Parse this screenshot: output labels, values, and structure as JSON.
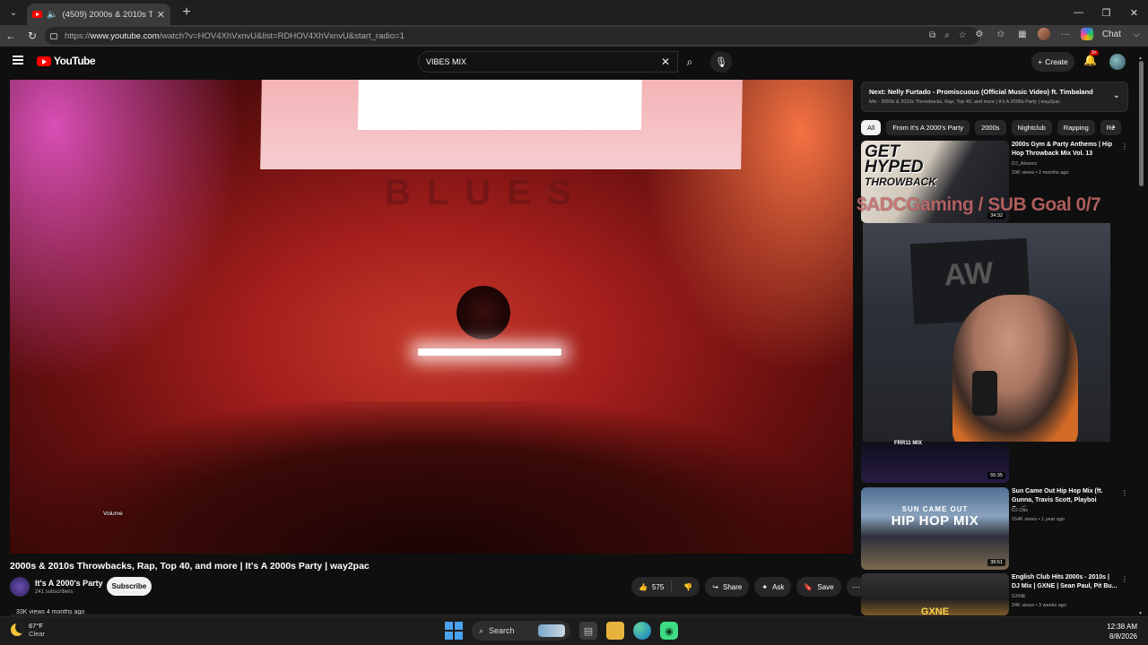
{
  "browser": {
    "tab_title": "(4509) 2000s & 2010s Throwb",
    "url_prefix": "https://",
    "url_host": "www.youtube.com",
    "url_path": "/watch?v=HOV4XhVxnvU&list=RDHOV4XhVxnvU&start_radio=1",
    "copilot_label": "Chat"
  },
  "yt": {
    "logo_text": "YouTube",
    "search_value": "VIBES MIX",
    "create_label": "Create",
    "notif_count": "9+"
  },
  "player": {
    "volume_tooltip": "Volume",
    "screen_text": "BLUES"
  },
  "video": {
    "title": "2000s & 2010s Throwbacks, Rap, Top 40, and more | It's A 2000s Party | way2pac",
    "channel": "It's A 2000's Party",
    "subscribers": "241 subscribers",
    "subscribe_label": "Subscribe",
    "likes": "575",
    "share_label": "Share",
    "ask_label": "Ask",
    "save_label": "Save",
    "views_peek": "33K views  4 months ago"
  },
  "upnext": {
    "line1": "Next: Nelly Furtado - Promiscuous (Official Music Video) ft. Timbaland",
    "line2": "Mix - 2000s & 2010s Throwbacks, Rap, Top 40, and more | It's A 2000s Party | way2pac"
  },
  "chips": [
    "All",
    "From It's A 2000's Party",
    "2000s",
    "Nightclub",
    "Rapping",
    "Re"
  ],
  "recommendations": [
    {
      "title": "2000s Gym & Party Anthems | Hip Hop Throwback Mix Vol. 13",
      "channel": "DJ_Alvarez",
      "meta": "19K views • 2 months ago",
      "duration": "34:32",
      "thumb_text_1": "GET",
      "thumb_text_2": "HYPED",
      "thumb_text_3": "THROWBACK"
    },
    {
      "title": "",
      "channel": "",
      "meta": "",
      "duration": "55:35",
      "thumb_text": "FRR11 MIX"
    },
    {
      "title": "Sun Came Out Hip Hop Mix (ft. Gunna, Travis Scott, Playboi Carti...",
      "channel": "DJ Otis",
      "meta": "154K views • 1 year ago",
      "duration": "38:51",
      "thumb_text_1": "SUN CAME OUT",
      "thumb_text_2": "HIP HOP MIX"
    },
    {
      "title": "English Club Hits 2000s - 2010s | DJ Mix | GXNE | Sean Paul, Pit Bu...",
      "channel": "GXNE",
      "meta": "24K views • 3 weeks ago",
      "thumb_text": "GXNE"
    }
  ],
  "stream_overlay": {
    "goal_text": "$ADCGaming / SUB Goal 0/7"
  },
  "taskbar": {
    "temp": "67°F",
    "condition": "Clear",
    "search_label": "Search",
    "time": "12:38 AM",
    "date": "8/8/2026"
  },
  "colors": {
    "yt_red": "#ff0000",
    "bg": "#0f0f0f",
    "chip_active": "#f1f1f1"
  }
}
